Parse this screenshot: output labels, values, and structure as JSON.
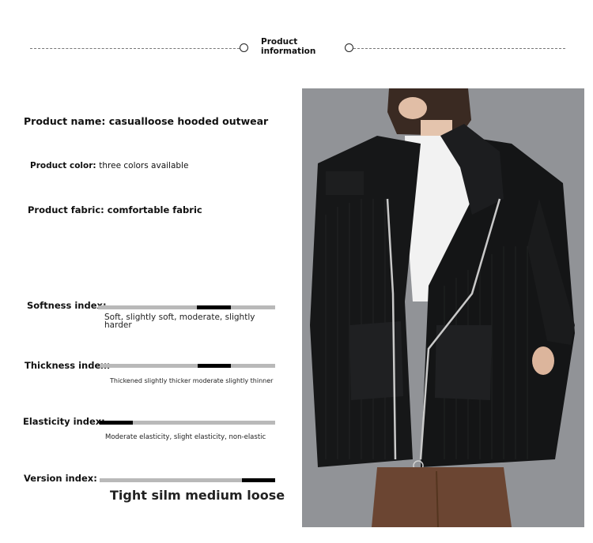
{
  "header": {
    "title_line1": "Product",
    "title_line2": "information"
  },
  "product": {
    "name_label": "Product name:",
    "name_value": "casualloose hooded outwear",
    "color_label": "Product color:",
    "color_value": "three colors available",
    "fabric_label": "Product fabric:",
    "fabric_value": "comfortable fabric"
  },
  "indices": [
    {
      "label": "Softness index:",
      "scale": "Soft, slightly soft, moderate, slightly harder",
      "indicator_start": 0.56,
      "indicator_end": 0.75
    },
    {
      "label": "Thickness index:",
      "scale": "Thickened slightly thicker moderate slightly thinner",
      "indicator_start": 0.56,
      "indicator_end": 0.75
    },
    {
      "label": "Elasticity index:",
      "scale": "Moderate elasticity, slight elasticity, non-elastic",
      "indicator_start": 0.0,
      "indicator_end": 0.19
    },
    {
      "label": "Version index:",
      "scale": "Tight silm medium loose",
      "indicator_start": 0.81,
      "indicator_end": 1.0
    }
  ],
  "photo": {
    "subject": "woman wearing black hooded zip cardigan over white t-shirt and brown trousers"
  },
  "colors": {
    "track": "#b9b9b9",
    "indicator": "#000000",
    "cardigan": "#151617",
    "background_wall": "#8c8f92"
  }
}
